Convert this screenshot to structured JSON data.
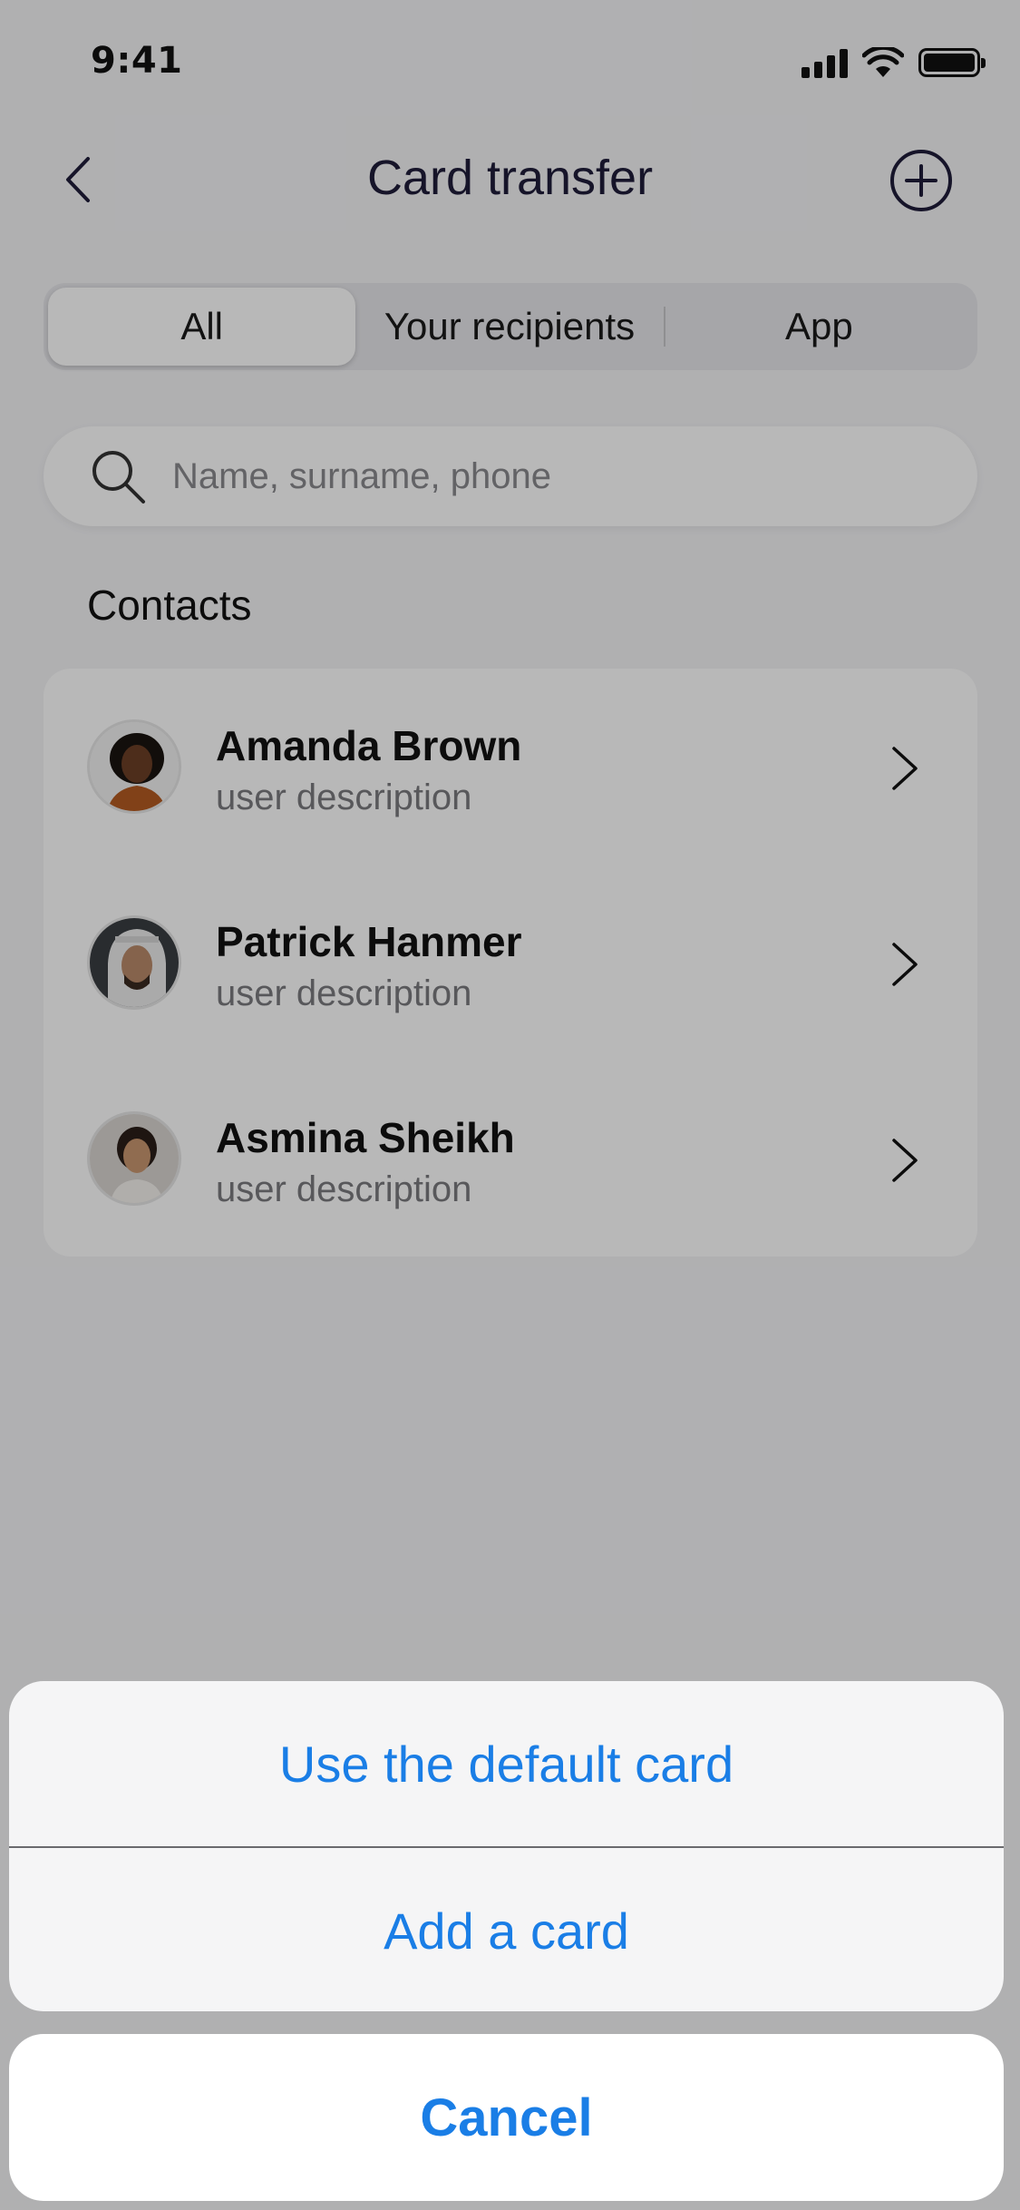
{
  "status_bar": {
    "time": "9:41"
  },
  "nav": {
    "title": "Card transfer"
  },
  "segments": [
    {
      "label": "All",
      "active": true
    },
    {
      "label": "Your recipients",
      "active": false
    },
    {
      "label": "App",
      "active": false
    }
  ],
  "search": {
    "placeholder": "Name, surname, phone"
  },
  "contacts": {
    "title": "Contacts",
    "items": [
      {
        "name": "Amanda Brown",
        "description": "user description"
      },
      {
        "name": "Patrick Hanmer",
        "description": "user description"
      },
      {
        "name": "Asmina Sheikh",
        "description": "user description"
      }
    ]
  },
  "action_sheet": {
    "options": [
      "Use the default card",
      "Add a card"
    ],
    "cancel": "Cancel"
  },
  "colors": {
    "accent": "#1a7ee6",
    "title": "#1f1d3a"
  },
  "icons": {
    "back": "chevron-left-icon",
    "add": "plus-circle-icon",
    "search": "search-icon",
    "row": "chevron-right-icon"
  }
}
